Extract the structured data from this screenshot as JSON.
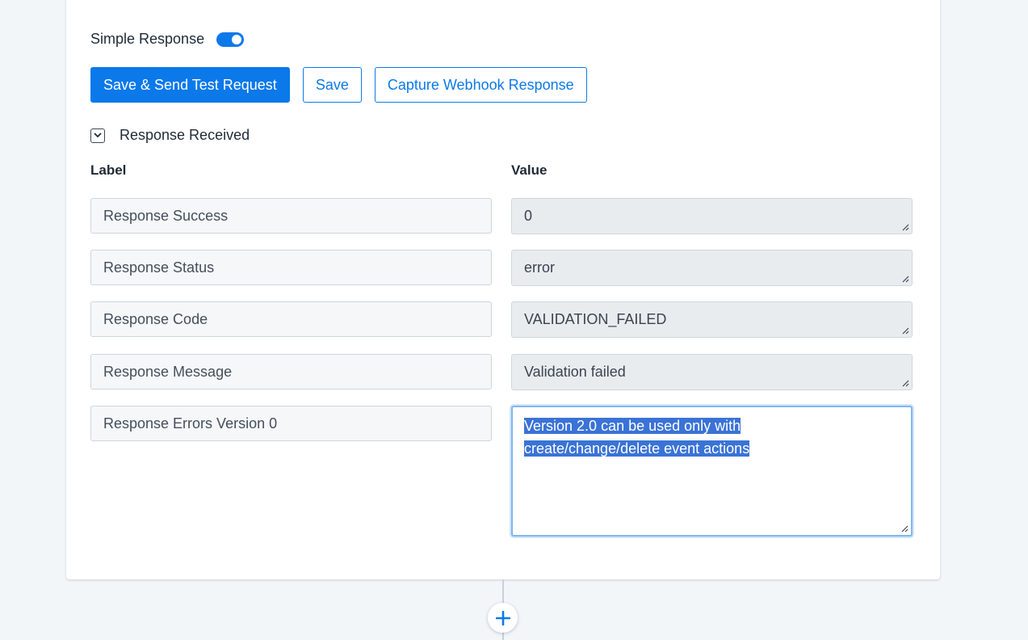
{
  "settings": {
    "simple_response_label": "Simple Response",
    "simple_response_on": true
  },
  "buttons": {
    "save_send_label": "Save & Send Test Request",
    "save_label": "Save",
    "capture_label": "Capture Webhook Response"
  },
  "response_section": {
    "title": "Response Received",
    "label_header": "Label",
    "value_header": "Value",
    "rows": [
      {
        "label": "Response Success",
        "value": "0"
      },
      {
        "label": "Response Status",
        "value": "error"
      },
      {
        "label": "Response Code",
        "value": "VALIDATION_FAILED"
      },
      {
        "label": "Response Message",
        "value": "Validation failed"
      },
      {
        "label": "Response Errors Version 0",
        "value_line1": "Version 2.0 can be used only with",
        "value_line2": "create/change/delete event actions"
      }
    ]
  },
  "icons": {
    "toggle": "toggle-switch",
    "collapse": "chevron-down-icon",
    "resize": "resize-grip-icon",
    "add": "plus-icon"
  },
  "colors": {
    "accent": "#0b79ea",
    "selection": "#3a73d6"
  }
}
